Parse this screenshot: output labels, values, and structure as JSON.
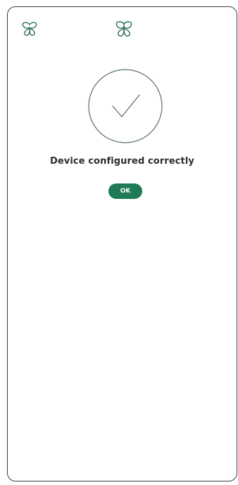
{
  "header": {
    "left_icon": "butterfly-logo-icon",
    "center_icon": "butterfly-logo-icon"
  },
  "status": {
    "icon": "checkmark-icon",
    "message": "Device configured correctly"
  },
  "actions": {
    "ok_label": "OK"
  },
  "colors": {
    "accent": "#1f7a56",
    "icon_stroke": "#2e6b5e",
    "text": "#2d2d2d",
    "frame": "#3a3a3a"
  }
}
